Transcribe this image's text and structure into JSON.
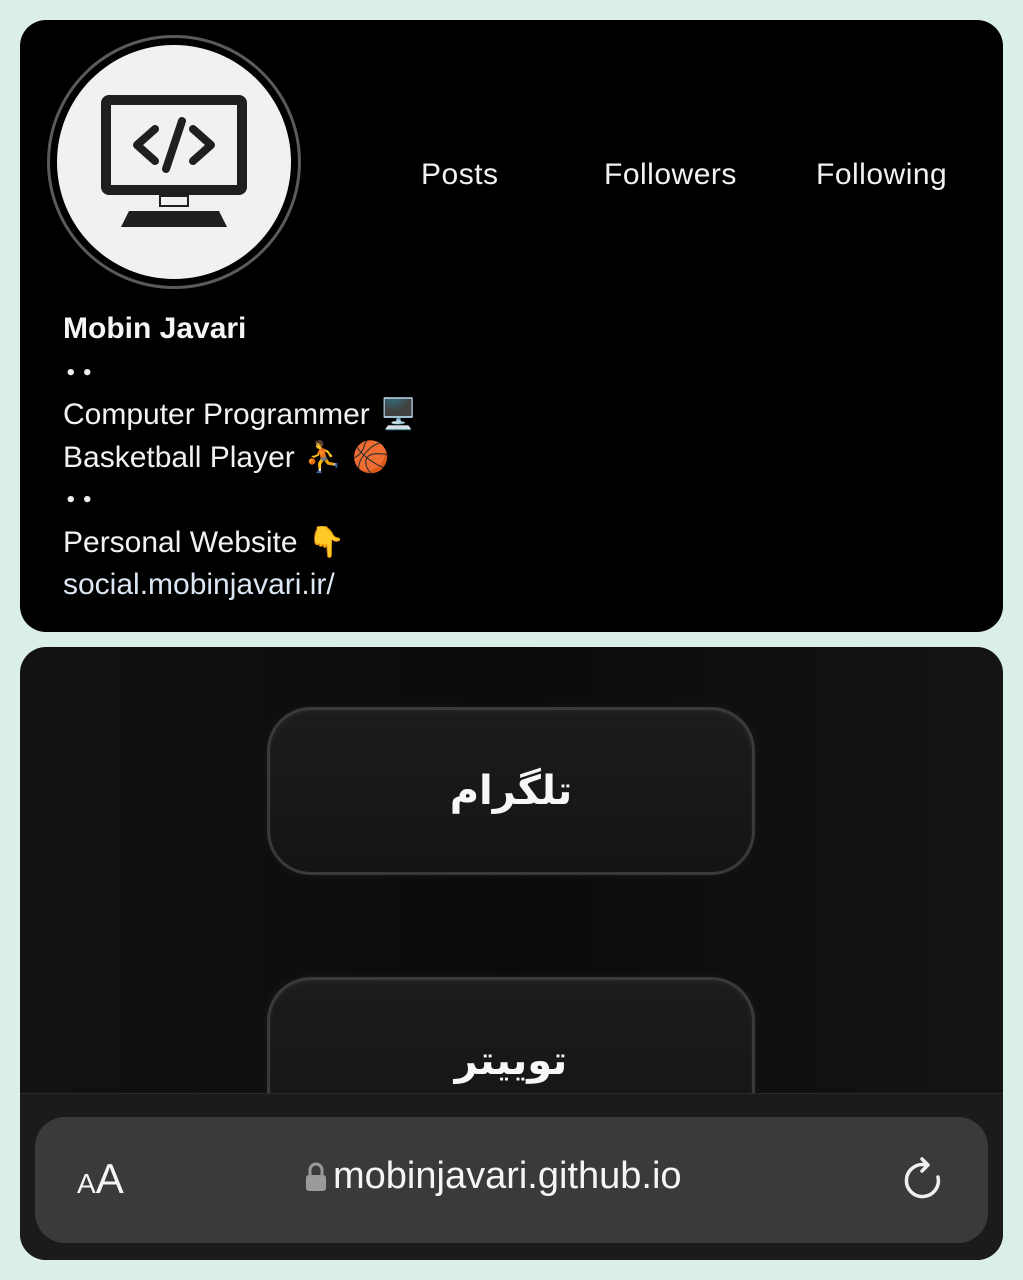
{
  "profile": {
    "stats": {
      "posts": "Posts",
      "followers": "Followers",
      "following": "Following"
    },
    "name": "Mobin Javari",
    "separator": "••",
    "bio_line1": "Computer Programmer",
    "bio_line2": "Basketball Player",
    "bio_line3": "Personal Website",
    "link": "social.mobinjavari.ir/",
    "emoji": {
      "computer": "🖥️",
      "player": "⛹️",
      "ball": "🏀",
      "pointing": "👇"
    }
  },
  "links": {
    "button1": "تلگرام",
    "button2": "توییتر"
  },
  "browser": {
    "text_size_small": "A",
    "text_size_big": "A",
    "url": "mobinjavari.github.io"
  }
}
